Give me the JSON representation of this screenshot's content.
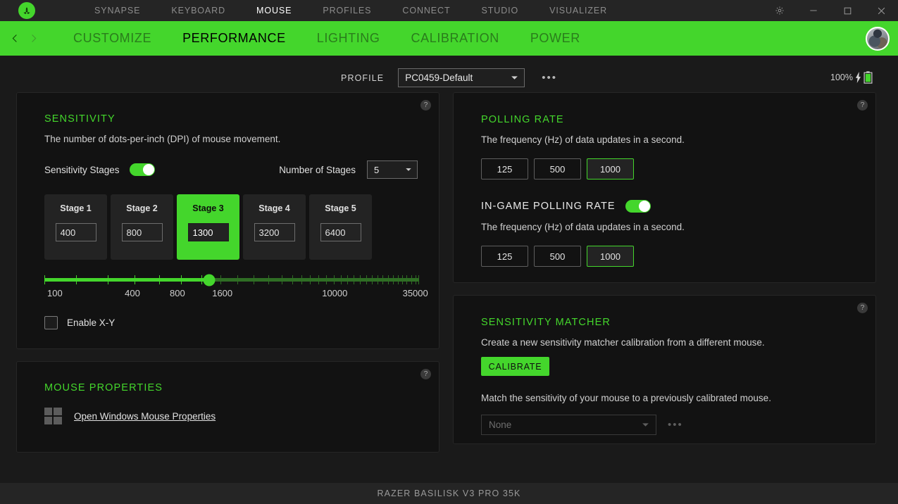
{
  "titlebar": {
    "logo": "razer-logo",
    "nav": [
      {
        "label": "SYNAPSE",
        "active": false
      },
      {
        "label": "KEYBOARD",
        "active": false
      },
      {
        "label": "MOUSE",
        "active": true
      },
      {
        "label": "PROFILES",
        "active": false
      },
      {
        "label": "CONNECT",
        "active": false
      },
      {
        "label": "STUDIO",
        "active": false
      },
      {
        "label": "VISUALIZER",
        "active": false
      }
    ],
    "controls": [
      "settings-gear",
      "minimize",
      "maximize",
      "close"
    ]
  },
  "subnav": {
    "back": "chevron-left-icon",
    "forward": "chevron-right-icon",
    "items": [
      {
        "label": "CUSTOMIZE",
        "active": false
      },
      {
        "label": "PERFORMANCE",
        "active": true
      },
      {
        "label": "LIGHTING",
        "active": false
      },
      {
        "label": "CALIBRATION",
        "active": false
      },
      {
        "label": "POWER",
        "active": false
      }
    ]
  },
  "profile": {
    "label": "PROFILE",
    "value": "PC0459-Default",
    "more": "•••"
  },
  "battery": {
    "percent": "100%",
    "charging_icon": "lightning-bolt-icon",
    "battery_icon": "battery-full-icon"
  },
  "sensitivity": {
    "title": "SENSITIVITY",
    "description": "The number of dots-per-inch (DPI) of mouse movement.",
    "stages_toggle_label": "Sensitivity Stages",
    "stages_toggle_on": true,
    "number_of_stages_label": "Number of Stages",
    "number_of_stages_value": "5",
    "stages": [
      {
        "label": "Stage 1",
        "value": "400",
        "active": false
      },
      {
        "label": "Stage 2",
        "value": "800",
        "active": false
      },
      {
        "label": "Stage 3",
        "value": "1300",
        "active": true
      },
      {
        "label": "Stage 4",
        "value": "3200",
        "active": false
      },
      {
        "label": "Stage 5",
        "value": "6400",
        "active": false
      }
    ],
    "slider": {
      "value": "1300",
      "ticks": [
        "100",
        "400",
        "800",
        "1600",
        "10000",
        "35000"
      ],
      "handle_percent": 44
    },
    "enable_xy_label": "Enable X-Y",
    "enable_xy_checked": false,
    "help": "?"
  },
  "mouse_properties": {
    "title": "MOUSE PROPERTIES",
    "link": "Open Windows Mouse Properties",
    "icon": "windows-logo-icon",
    "help": "?"
  },
  "polling_rate": {
    "title": "POLLING RATE",
    "description": "The frequency (Hz) of data updates in a second.",
    "options": [
      {
        "label": "125",
        "active": false
      },
      {
        "label": "500",
        "active": false
      },
      {
        "label": "1000",
        "active": true
      }
    ],
    "ingame_title": "IN-GAME POLLING RATE",
    "ingame_toggle_on": true,
    "ingame_description": "The frequency (Hz) of data updates in a second.",
    "ingame_options": [
      {
        "label": "125",
        "active": false
      },
      {
        "label": "500",
        "active": false
      },
      {
        "label": "1000",
        "active": true
      }
    ],
    "help": "?"
  },
  "sensitivity_matcher": {
    "title": "SENSITIVITY MATCHER",
    "description": "Create a new sensitivity matcher calibration from a different mouse.",
    "calibrate_label": "CALIBRATE",
    "match_description": "Match the sensitivity of your mouse to a previously calibrated mouse.",
    "select_value": "None",
    "more": "•••",
    "help": "?"
  },
  "footer": {
    "device_name": "RAZER BASILISK V3 PRO 35K"
  },
  "colors": {
    "accent": "#44d62c",
    "accent_dark": "#2f6d24",
    "bg": "#1a1a1a",
    "card_bg": "#121212",
    "bar_bg": "#252525"
  }
}
